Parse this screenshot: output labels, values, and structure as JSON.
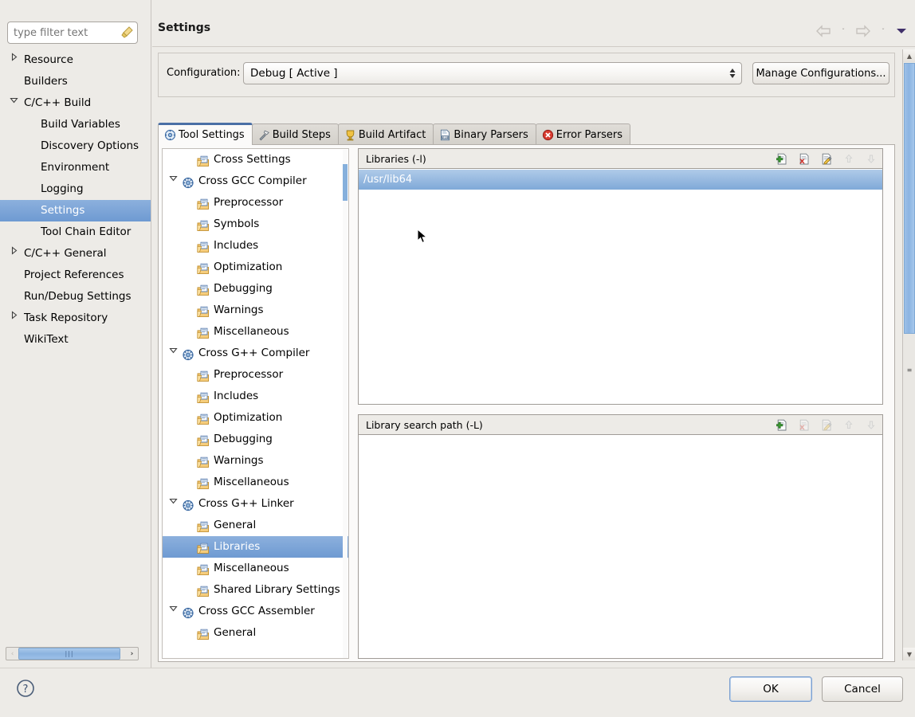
{
  "window": {
    "title": "Settings"
  },
  "sidebar": {
    "filter": {
      "placeholder": "type filter text",
      "value": "",
      "icon": "clear-filter-icon"
    },
    "items": [
      {
        "label": "Resource",
        "level": 0,
        "twisty": "collapsed",
        "selected": false
      },
      {
        "label": "Builders",
        "level": 0,
        "twisty": "none",
        "selected": false
      },
      {
        "label": "C/C++ Build",
        "level": 0,
        "twisty": "expanded",
        "selected": false
      },
      {
        "label": "Build Variables",
        "level": 1,
        "twisty": "none",
        "selected": false
      },
      {
        "label": "Discovery Options",
        "level": 1,
        "twisty": "none",
        "selected": false
      },
      {
        "label": "Environment",
        "level": 1,
        "twisty": "none",
        "selected": false
      },
      {
        "label": "Logging",
        "level": 1,
        "twisty": "none",
        "selected": false
      },
      {
        "label": "Settings",
        "level": 1,
        "twisty": "none",
        "selected": true
      },
      {
        "label": "Tool Chain Editor",
        "level": 1,
        "twisty": "none",
        "selected": false
      },
      {
        "label": "C/C++ General",
        "level": 0,
        "twisty": "collapsed",
        "selected": false
      },
      {
        "label": "Project References",
        "level": 0,
        "twisty": "none",
        "selected": false
      },
      {
        "label": "Run/Debug Settings",
        "level": 0,
        "twisty": "none",
        "selected": false
      },
      {
        "label": "Task Repository",
        "level": 0,
        "twisty": "collapsed",
        "selected": false
      },
      {
        "label": "WikiText",
        "level": 0,
        "twisty": "none",
        "selected": false
      }
    ],
    "hscrollbar": {
      "left_arrow": "‹",
      "right_arrow": "›",
      "grip": "|||"
    }
  },
  "navigation": {
    "back": "back-arrow-icon",
    "back_menu": "ˇ",
    "forward": "forward-arrow-icon",
    "forward_menu": "ˇ",
    "view_menu": "▼"
  },
  "configuration": {
    "label": "Configuration:",
    "value": "Debug  [ Active ]",
    "manage_button": "Manage Configurations..."
  },
  "tabs": [
    {
      "label": "Tool Settings",
      "icon": "tool-settings-icon",
      "active": true
    },
    {
      "label": "Build Steps",
      "icon": "build-steps-icon",
      "active": false
    },
    {
      "label": "Build Artifact",
      "icon": "build-artifact-icon",
      "active": false
    },
    {
      "label": "Binary Parsers",
      "icon": "binary-parsers-icon",
      "active": false
    },
    {
      "label": "Error Parsers",
      "icon": "error-parsers-icon",
      "active": false
    }
  ],
  "tool_tree": [
    {
      "label": "Cross Settings",
      "depth": 1,
      "twisty": "none",
      "icon": "folder-page-icon",
      "selected": false
    },
    {
      "label": "Cross GCC Compiler",
      "depth": 0,
      "twisty": "expanded",
      "icon": "tool-gear-icon",
      "selected": false
    },
    {
      "label": "Preprocessor",
      "depth": 1,
      "twisty": "none",
      "icon": "folder-page-icon",
      "selected": false
    },
    {
      "label": "Symbols",
      "depth": 1,
      "twisty": "none",
      "icon": "folder-page-icon",
      "selected": false
    },
    {
      "label": "Includes",
      "depth": 1,
      "twisty": "none",
      "icon": "folder-page-icon",
      "selected": false
    },
    {
      "label": "Optimization",
      "depth": 1,
      "twisty": "none",
      "icon": "folder-page-icon",
      "selected": false
    },
    {
      "label": "Debugging",
      "depth": 1,
      "twisty": "none",
      "icon": "folder-page-icon",
      "selected": false
    },
    {
      "label": "Warnings",
      "depth": 1,
      "twisty": "none",
      "icon": "folder-page-icon",
      "selected": false
    },
    {
      "label": "Miscellaneous",
      "depth": 1,
      "twisty": "none",
      "icon": "folder-page-icon",
      "selected": false
    },
    {
      "label": "Cross G++ Compiler",
      "depth": 0,
      "twisty": "expanded",
      "icon": "tool-gear-icon",
      "selected": false
    },
    {
      "label": "Preprocessor",
      "depth": 1,
      "twisty": "none",
      "icon": "folder-page-icon",
      "selected": false
    },
    {
      "label": "Includes",
      "depth": 1,
      "twisty": "none",
      "icon": "folder-page-icon",
      "selected": false
    },
    {
      "label": "Optimization",
      "depth": 1,
      "twisty": "none",
      "icon": "folder-page-icon",
      "selected": false
    },
    {
      "label": "Debugging",
      "depth": 1,
      "twisty": "none",
      "icon": "folder-page-icon",
      "selected": false
    },
    {
      "label": "Warnings",
      "depth": 1,
      "twisty": "none",
      "icon": "folder-page-icon",
      "selected": false
    },
    {
      "label": "Miscellaneous",
      "depth": 1,
      "twisty": "none",
      "icon": "folder-page-icon",
      "selected": false
    },
    {
      "label": "Cross G++ Linker",
      "depth": 0,
      "twisty": "expanded",
      "icon": "tool-gear-icon",
      "selected": false
    },
    {
      "label": "General",
      "depth": 1,
      "twisty": "none",
      "icon": "folder-page-icon",
      "selected": false
    },
    {
      "label": "Libraries",
      "depth": 1,
      "twisty": "none",
      "icon": "folder-page-icon",
      "selected": true
    },
    {
      "label": "Miscellaneous",
      "depth": 1,
      "twisty": "none",
      "icon": "folder-page-icon",
      "selected": false
    },
    {
      "label": "Shared Library Settings",
      "depth": 1,
      "twisty": "none",
      "icon": "folder-page-icon",
      "selected": false
    },
    {
      "label": "Cross GCC Assembler",
      "depth": 0,
      "twisty": "expanded",
      "icon": "tool-gear-icon",
      "selected": false
    },
    {
      "label": "General",
      "depth": 1,
      "twisty": "none",
      "icon": "folder-page-icon",
      "selected": false
    }
  ],
  "libraries_panel": {
    "title": "Libraries (-l)",
    "tools": [
      {
        "name": "add-icon",
        "enabled": true
      },
      {
        "name": "delete-icon",
        "enabled": true
      },
      {
        "name": "edit-icon",
        "enabled": true
      },
      {
        "name": "move-up-icon",
        "enabled": false
      },
      {
        "name": "move-down-icon",
        "enabled": false
      }
    ],
    "items": [
      {
        "value": "/usr/lib64",
        "selected": true
      }
    ]
  },
  "library_search_path_panel": {
    "title": "Library search path (-L)",
    "tools": [
      {
        "name": "add-icon",
        "enabled": true
      },
      {
        "name": "delete-icon",
        "enabled": false
      },
      {
        "name": "edit-icon",
        "enabled": false
      },
      {
        "name": "move-up-icon",
        "enabled": false
      },
      {
        "name": "move-down-icon",
        "enabled": false
      }
    ],
    "items": []
  },
  "footer": {
    "help": "help-icon",
    "ok": "OK",
    "cancel": "Cancel"
  },
  "colors": {
    "selection_blue": "#6e9ad2",
    "active_tab_accent": "#4a6fa5",
    "dialog_bg": "#edebe7",
    "list_bg": "#ffffff"
  }
}
